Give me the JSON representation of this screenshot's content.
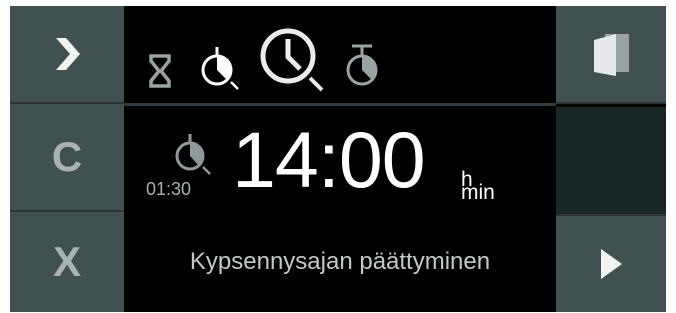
{
  "left_buttons": {
    "next": {
      "icon": "chevron-right-icon"
    },
    "clear": {
      "label": "C"
    },
    "cancel": {
      "label": "X"
    }
  },
  "mode_icons": [
    "hourglass-icon",
    "cooking-end-clock-icon",
    "clock-icon",
    "stopwatch-icon"
  ],
  "main": {
    "sub_time": "01:30",
    "time": "14:00",
    "unit_h": "h",
    "unit_min": "min",
    "caption": "Kypsennysajan päättyminen"
  },
  "right_buttons": {
    "door": {
      "icon": "door-icon"
    },
    "play": {
      "icon": "play-icon"
    }
  },
  "colors": {
    "button_bg": "#415050",
    "panel_bg": "#000000",
    "text": "#ffffff",
    "dim_text": "#a7b0b0"
  }
}
